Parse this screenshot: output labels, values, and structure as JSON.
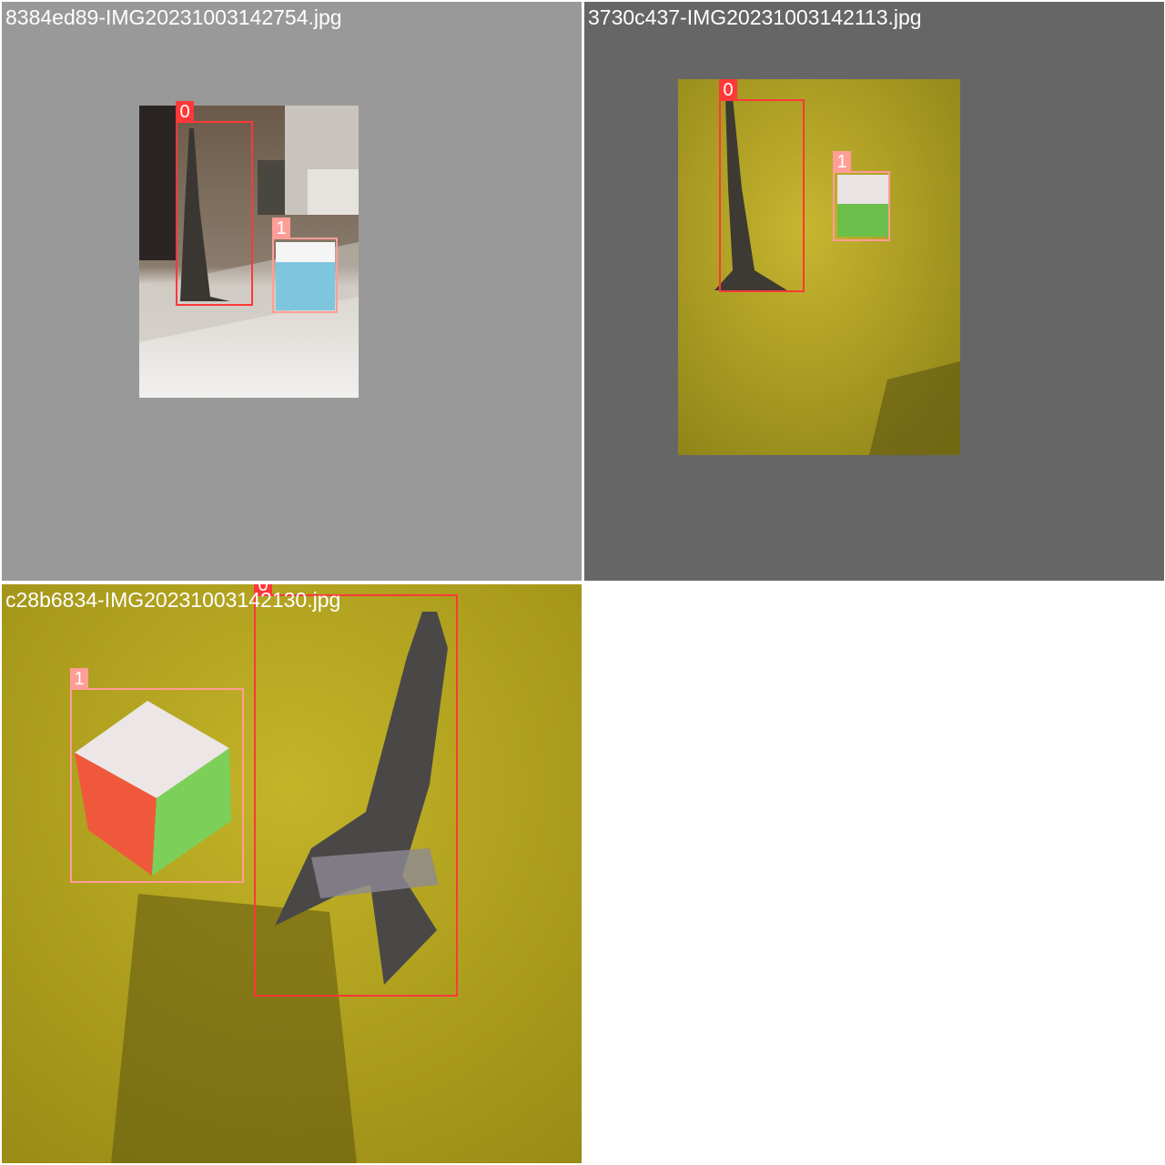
{
  "mosaic": {
    "tiles": [
      {
        "filename": "8384ed89-IMG20231003142754.jpg",
        "detections": [
          {
            "class_label": "0"
          },
          {
            "class_label": "1"
          }
        ]
      },
      {
        "filename": "3730c437-IMG20231003142113.jpg",
        "detections": [
          {
            "class_label": "0"
          },
          {
            "class_label": "1"
          }
        ]
      },
      {
        "filename": "c28b6834-IMG20231003142130.jpg",
        "detections": [
          {
            "class_label": "0"
          },
          {
            "class_label": "1"
          }
        ]
      }
    ]
  },
  "colors": {
    "class_0": "#ff3838",
    "class_1": "#ff9d97",
    "letterbox_light": "#999999",
    "letterbox_dark": "#666666",
    "surface_yellow": "#b8a81a"
  }
}
